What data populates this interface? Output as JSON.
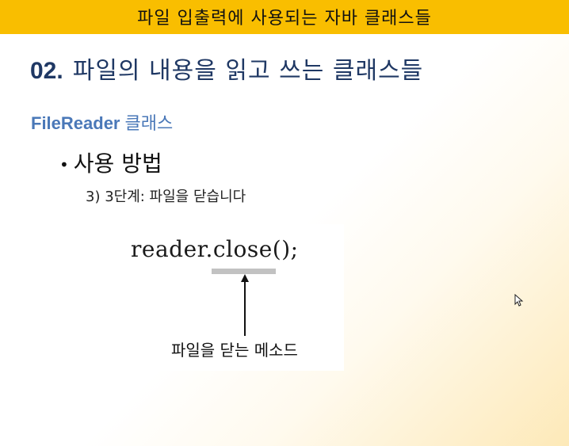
{
  "header": {
    "title": "파일 입출력에 사용되는 자바 클래스들"
  },
  "section": {
    "number": "02.",
    "title": "파일의 내용을 읽고 쓰는 클래스들"
  },
  "subsection": {
    "class_name": "FileReader",
    "suffix": "클래스"
  },
  "bullet": {
    "text": "사용 방법"
  },
  "step": {
    "text": "3) 3단계: 파일을 닫습니다"
  },
  "figure": {
    "code": "reader.close();",
    "caption": "파일을 닫는 메소드"
  },
  "colors": {
    "header_bg": "#f9be00",
    "heading": "#1f3864",
    "subheading": "#4a78b8"
  }
}
